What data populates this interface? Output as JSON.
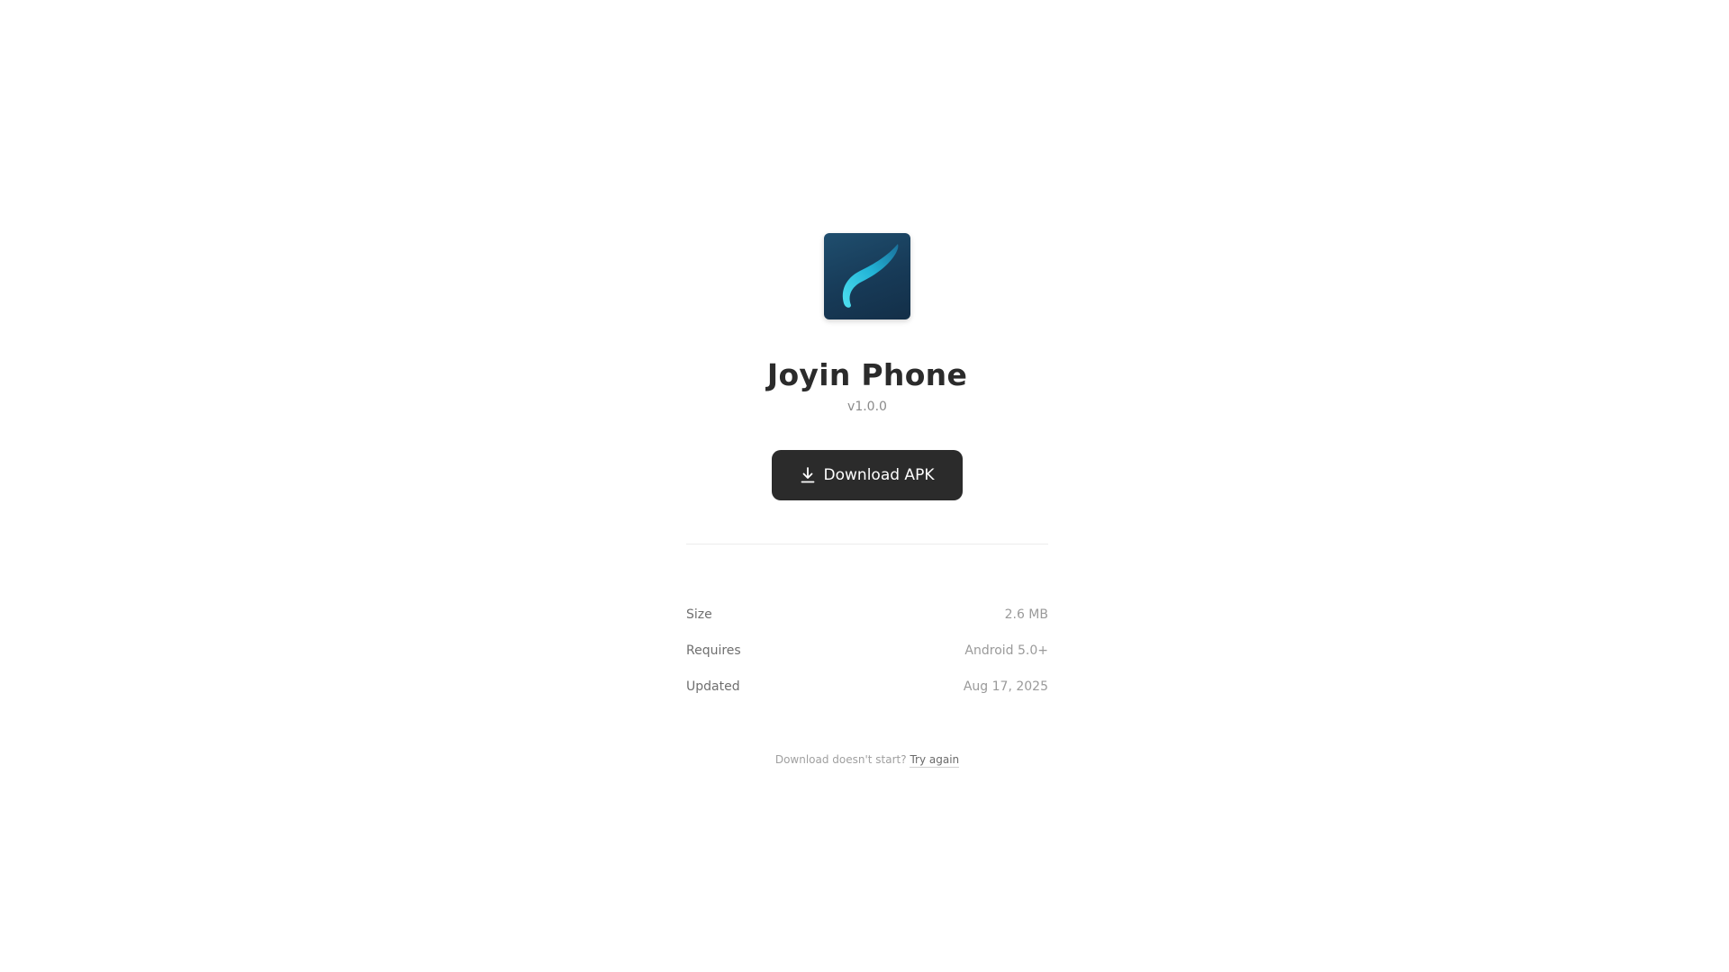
{
  "app": {
    "name": "Joyin Phone",
    "version": "v1.0.0",
    "icon": "joyin-logo-icon"
  },
  "download_button": {
    "label": "Download APK",
    "icon": "download-icon"
  },
  "details": [
    {
      "label": "Size",
      "value": "2.6 MB"
    },
    {
      "label": "Requires",
      "value": "Android 5.0+"
    },
    {
      "label": "Updated",
      "value": "Aug 17, 2025"
    }
  ],
  "footer": {
    "prompt": "Download doesn't start?",
    "retry_label": "Try again"
  },
  "colors": {
    "button_bg": "#2b2b2b",
    "icon_bg": "#173a57",
    "icon_accent": "#2fc4e0"
  }
}
